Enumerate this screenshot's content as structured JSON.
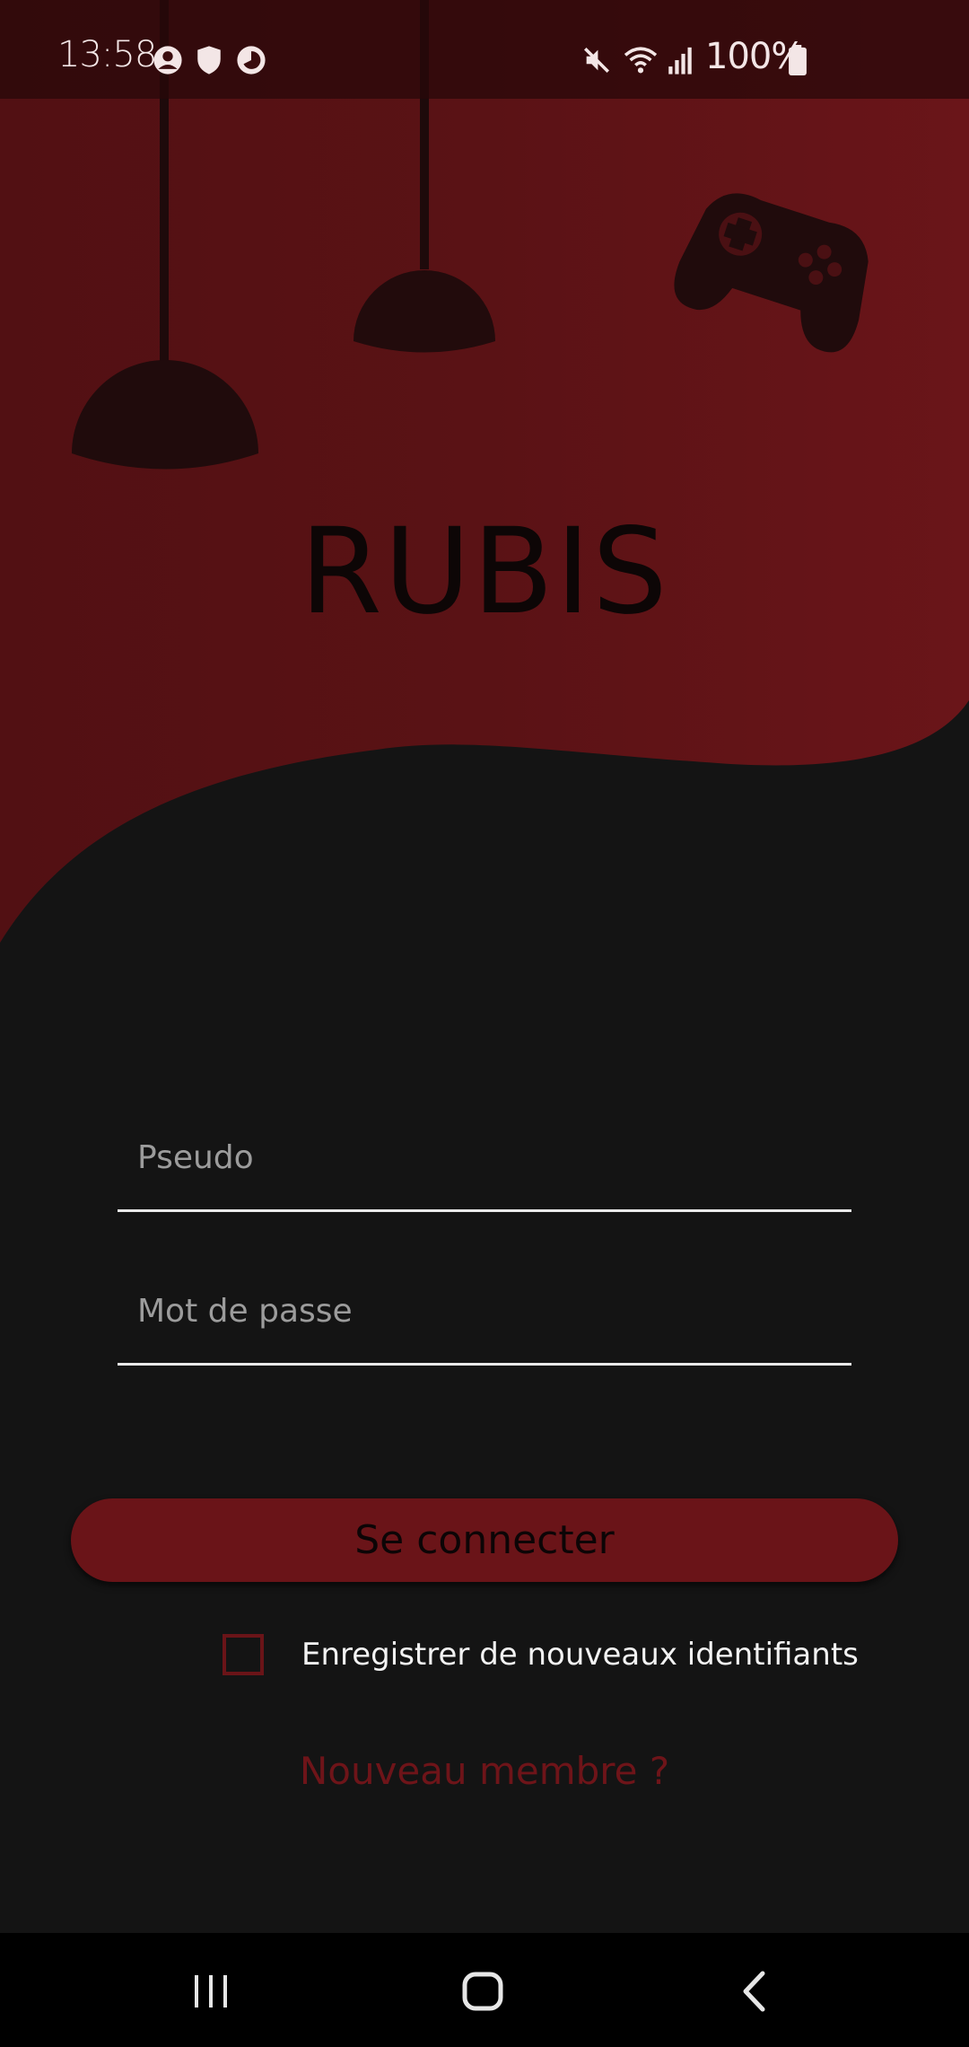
{
  "status_bar": {
    "time": "13:58",
    "battery": "100%",
    "left_icons": [
      "account-circle-icon",
      "shield-icon",
      "data-saver-icon"
    ],
    "right_icons": [
      "mute-icon",
      "wifi-icon",
      "signal-icon",
      "battery-icon"
    ]
  },
  "app": {
    "title": "RUBIS"
  },
  "login_form": {
    "username": {
      "value": "",
      "placeholder": "Pseudo"
    },
    "password": {
      "value": "",
      "placeholder": "Mot de passe"
    },
    "submit_label": "Se connecter",
    "remember": {
      "label": "Enregistrer de nouveaux identifiants",
      "checked": false
    },
    "signup_link": "Nouveau membre ?"
  },
  "nav_bar": {
    "buttons": [
      "recents-icon",
      "home-icon",
      "back-icon"
    ]
  },
  "colors": {
    "accent_red": "#6a1418",
    "background": "#141414",
    "hero_red": "#5e1417"
  }
}
